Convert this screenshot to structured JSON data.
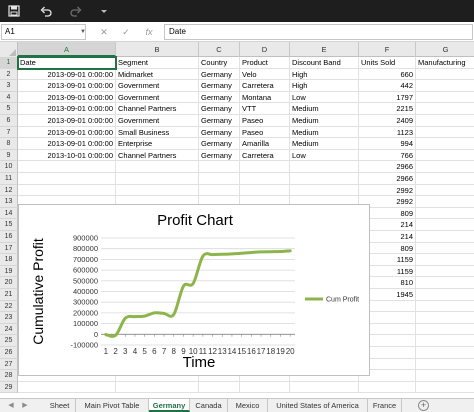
{
  "titlebar": {
    "save_icon": "save-icon",
    "undo_icon": "undo-icon",
    "redo_icon": "redo-icon",
    "customize_icon": "dropdown-icon"
  },
  "formula_bar": {
    "name_box": "A1",
    "cancel": "✕",
    "enter": "✓",
    "fx": "fx",
    "content": "Date"
  },
  "columns": [
    "A",
    "B",
    "C",
    "D",
    "E",
    "F",
    "G"
  ],
  "rows": [
    {
      "n": "1",
      "a": "Date",
      "b": "Segment",
      "c": "Country",
      "d": "Product",
      "e": "Discount Band",
      "f": "Units Sold",
      "g": "Manufacturing"
    },
    {
      "n": "2",
      "a": "2013-09-01 0:00:00",
      "b": "Midmarket",
      "c": "Germany",
      "d": "Velo",
      "e": "High",
      "f": "660",
      "g": ""
    },
    {
      "n": "3",
      "a": "2013-09-01 0:00:00",
      "b": "Government",
      "c": "Germany",
      "d": "Carretera",
      "e": "High",
      "f": "442",
      "g": ""
    },
    {
      "n": "4",
      "a": "2013-09-01 0:00:00",
      "b": "Government",
      "c": "Germany",
      "d": "Montana",
      "e": "Low",
      "f": "1797",
      "g": ""
    },
    {
      "n": "5",
      "a": "2013-09-01 0:00:00",
      "b": "Channel Partners",
      "c": "Germany",
      "d": "VTT",
      "e": "Medium",
      "f": "2215",
      "g": ""
    },
    {
      "n": "6",
      "a": "2013-09-01 0:00:00",
      "b": "Government",
      "c": "Germany",
      "d": "Paseo",
      "e": "Medium",
      "f": "2409",
      "g": ""
    },
    {
      "n": "7",
      "a": "2013-09-01 0:00:00",
      "b": "Small Business",
      "c": "Germany",
      "d": "Paseo",
      "e": "Medium",
      "f": "1123",
      "g": ""
    },
    {
      "n": "8",
      "a": "2013-09-01 0:00:00",
      "b": "Enterprise",
      "c": "Germany",
      "d": "Amarilla",
      "e": "Medium",
      "f": "994",
      "g": ""
    },
    {
      "n": "9",
      "a": "2013-10-01 0:00:00",
      "b": "Channel Partners",
      "c": "Germany",
      "d": "Carretera",
      "e": "Low",
      "f": "766",
      "g": ""
    },
    {
      "n": "10",
      "a": "",
      "b": "",
      "c": "",
      "d": "",
      "e": "",
      "f": "2966",
      "g": ""
    },
    {
      "n": "11",
      "a": "",
      "b": "",
      "c": "",
      "d": "",
      "e": "",
      "f": "2966",
      "g": ""
    },
    {
      "n": "12",
      "a": "",
      "b": "",
      "c": "",
      "d": "",
      "e": "",
      "f": "2992",
      "g": ""
    },
    {
      "n": "13",
      "a": "",
      "b": "",
      "c": "",
      "d": "",
      "e": "",
      "f": "2992",
      "g": ""
    },
    {
      "n": "14",
      "a": "",
      "b": "",
      "c": "",
      "d": "",
      "e": "",
      "f": "809",
      "g": ""
    },
    {
      "n": "15",
      "a": "",
      "b": "",
      "c": "",
      "d": "",
      "e": "",
      "f": "214",
      "g": ""
    },
    {
      "n": "16",
      "a": "",
      "b": "",
      "c": "",
      "d": "",
      "e": "",
      "f": "214",
      "g": ""
    },
    {
      "n": "17",
      "a": "",
      "b": "",
      "c": "",
      "d": "",
      "e": "",
      "f": "809",
      "g": ""
    },
    {
      "n": "18",
      "a": "",
      "b": "",
      "c": "",
      "d": "",
      "e": "",
      "f": "1159",
      "g": ""
    },
    {
      "n": "19",
      "a": "",
      "b": "",
      "c": "",
      "d": "",
      "e": "",
      "f": "1159",
      "g": ""
    },
    {
      "n": "20",
      "a": "",
      "b": "",
      "c": "",
      "d": "",
      "e": "",
      "f": "810",
      "g": ""
    },
    {
      "n": "21",
      "a": "",
      "b": "",
      "c": "",
      "d": "",
      "e": "",
      "f": "1945",
      "g": ""
    },
    {
      "n": "22",
      "a": "",
      "b": "",
      "c": "",
      "d": "",
      "e": "",
      "f": "",
      "g": ""
    },
    {
      "n": "23",
      "a": "",
      "b": "",
      "c": "",
      "d": "",
      "e": "",
      "f": "",
      "g": ""
    },
    {
      "n": "24",
      "a": "",
      "b": "",
      "c": "",
      "d": "",
      "e": "",
      "f": "",
      "g": ""
    },
    {
      "n": "25",
      "a": "",
      "b": "",
      "c": "",
      "d": "",
      "e": "",
      "f": "",
      "g": ""
    },
    {
      "n": "26",
      "a": "",
      "b": "",
      "c": "",
      "d": "",
      "e": "",
      "f": "",
      "g": ""
    },
    {
      "n": "27",
      "a": "",
      "b": "",
      "c": "",
      "d": "",
      "e": "",
      "f": "",
      "g": ""
    },
    {
      "n": "28",
      "a": "",
      "b": "",
      "c": "",
      "d": "",
      "e": "",
      "f": "",
      "g": ""
    },
    {
      "n": "29",
      "a": "",
      "b": "",
      "c": "",
      "d": "",
      "e": "",
      "f": "",
      "g": ""
    }
  ],
  "chart_data": {
    "type": "line",
    "title": "Profit Chart",
    "xlabel": "Time",
    "ylabel": "Cumulative Profit",
    "x": [
      1,
      2,
      3,
      4,
      5,
      6,
      7,
      8,
      9,
      10,
      11,
      12,
      13,
      14,
      15,
      16,
      17,
      18,
      19,
      20
    ],
    "series": [
      {
        "name": "Cum Profit",
        "values": [
          -2000,
          -10000,
          150000,
          165000,
          170000,
          200000,
          195000,
          185000,
          450000,
          475000,
          730000,
          745000,
          748000,
          752000,
          758000,
          765000,
          770000,
          772000,
          774000,
          780000
        ]
      }
    ],
    "ylim": [
      -100000,
      900000
    ],
    "yticks": [
      -100000,
      0,
      100000,
      200000,
      300000,
      400000,
      500000,
      600000,
      700000,
      800000,
      900000
    ],
    "grid": true,
    "legend": "right",
    "line_color": "#8db54b"
  },
  "tabs": {
    "prev_icon": "◀",
    "next_icon": "▶",
    "items": [
      {
        "label": "Sheet",
        "active": false
      },
      {
        "label": "Main Pivot Table",
        "active": false
      },
      {
        "label": "Germany",
        "active": true
      },
      {
        "label": "Canada",
        "active": false
      },
      {
        "label": "Mexico",
        "active": false
      },
      {
        "label": "United States of America",
        "active": false
      },
      {
        "label": "France",
        "active": false
      }
    ],
    "add_label": "+"
  }
}
